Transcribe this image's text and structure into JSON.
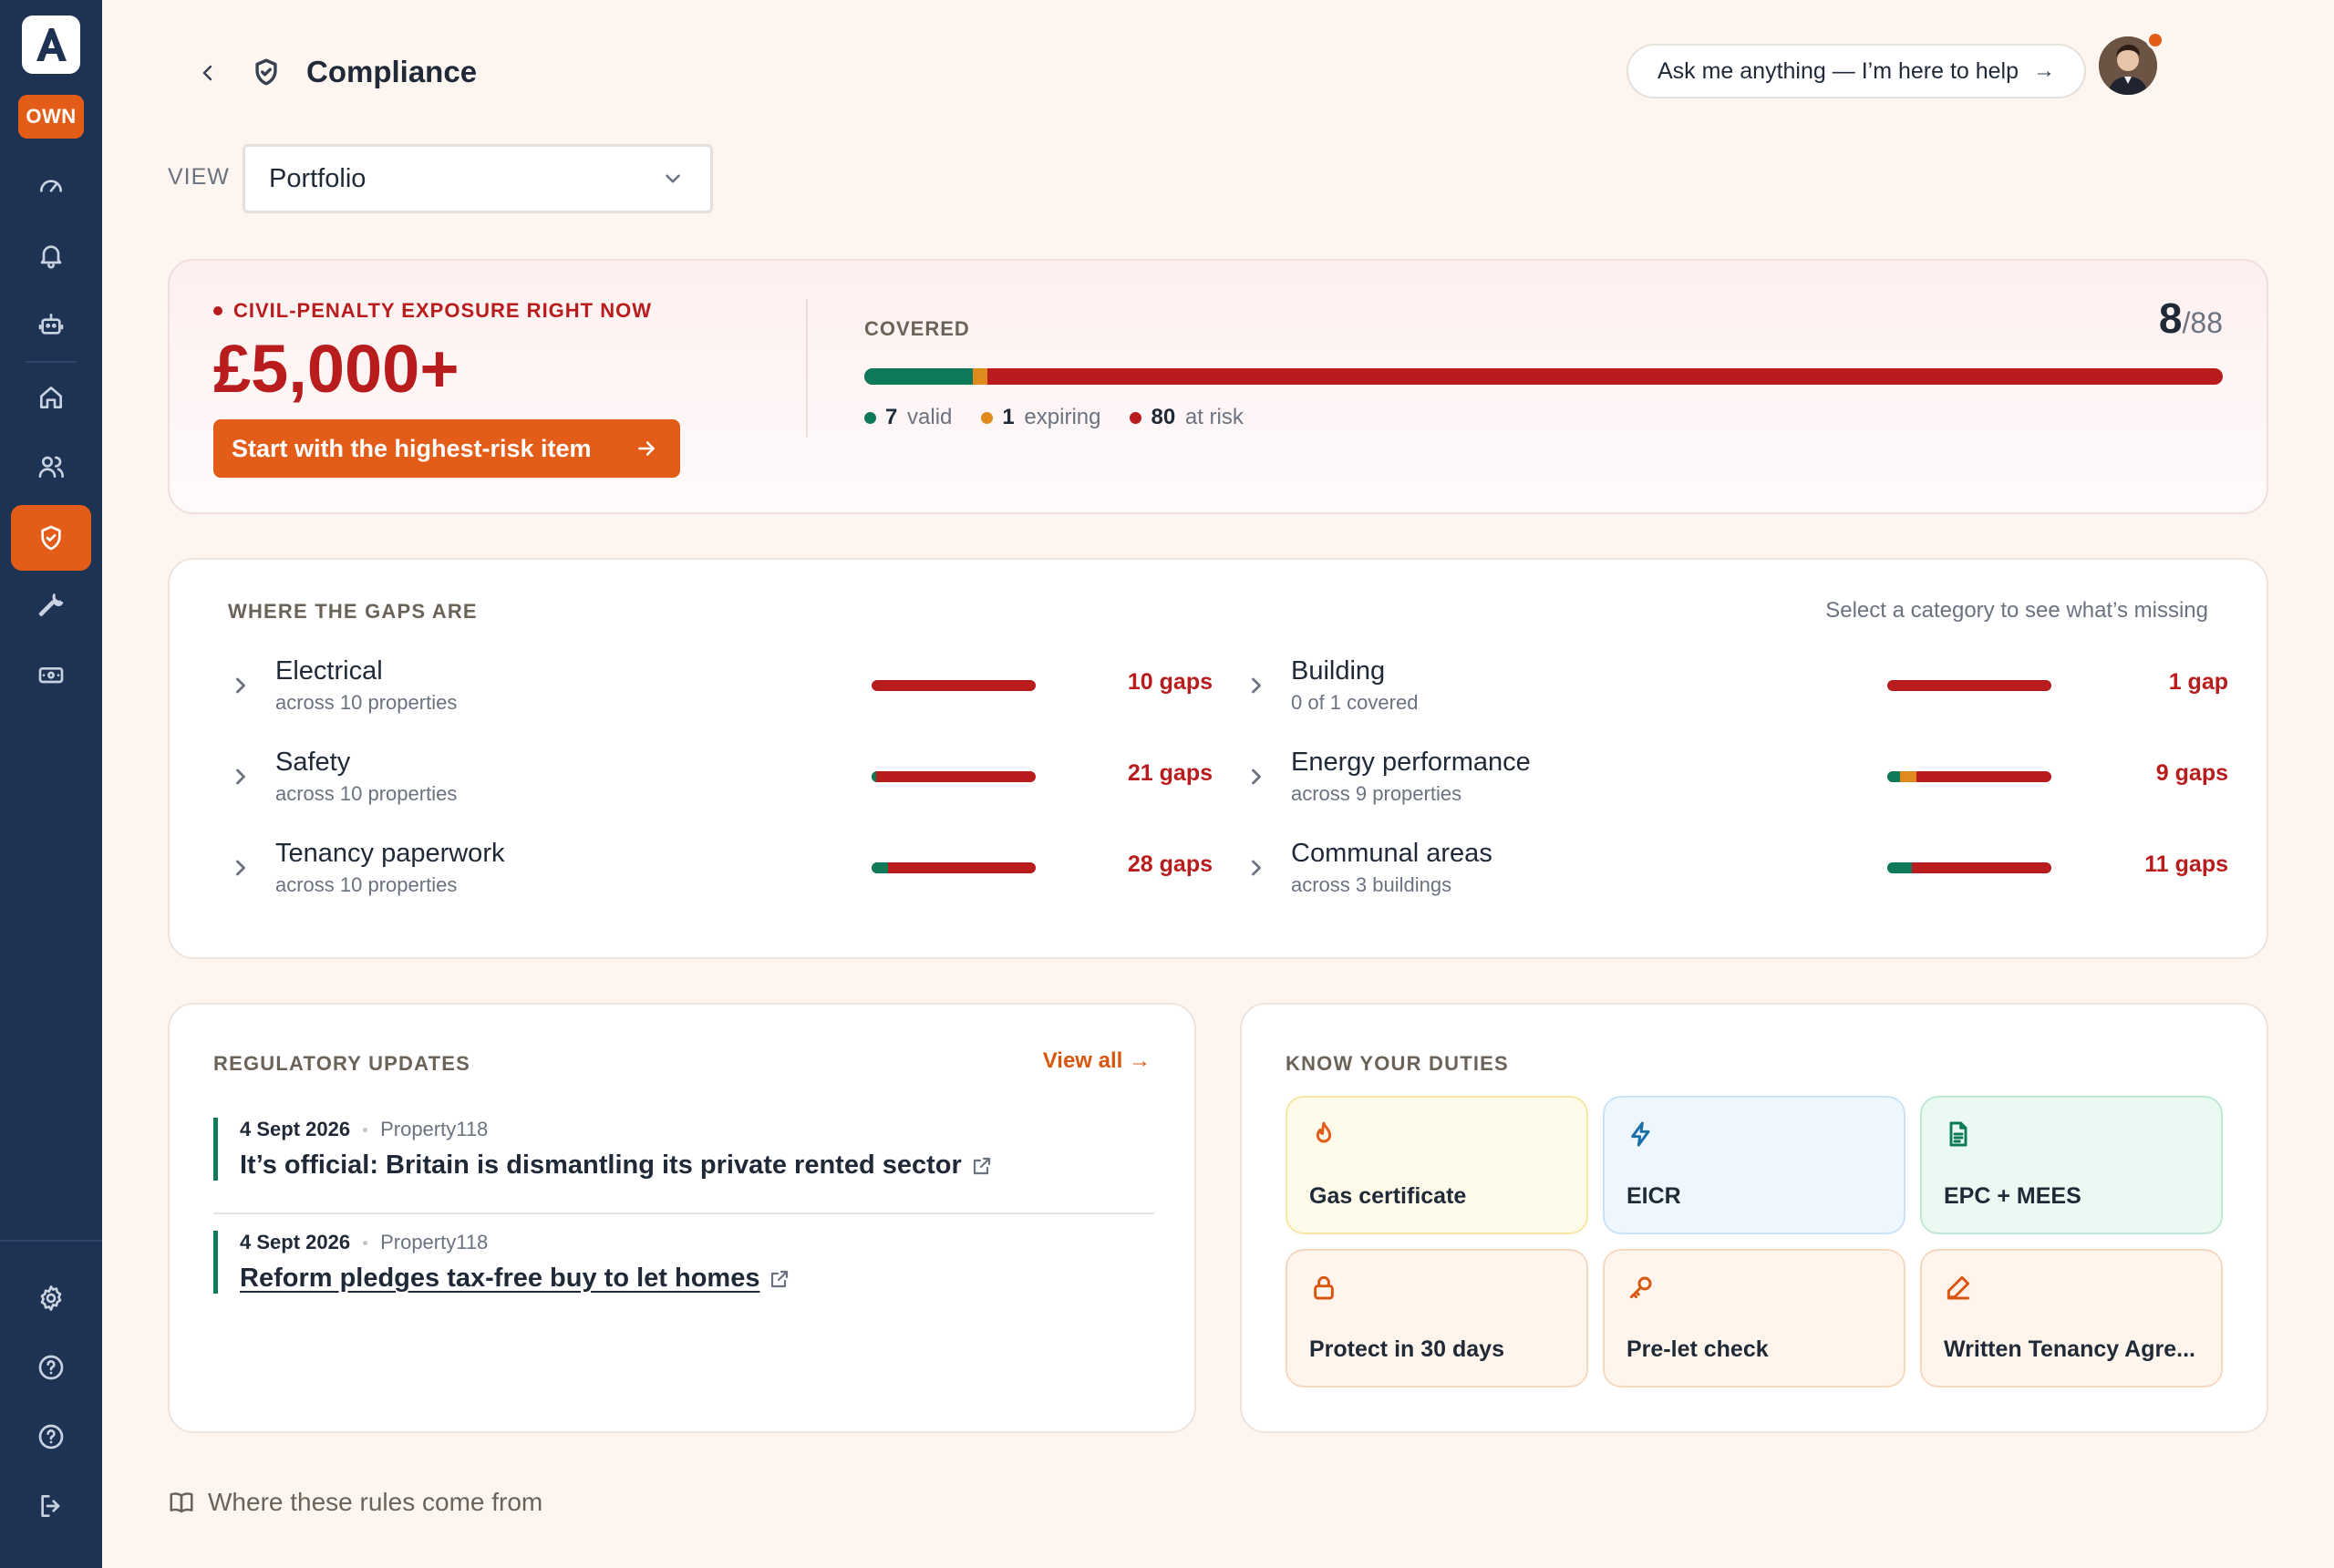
{
  "app": {
    "logo_letter": "A",
    "badge": "OWN"
  },
  "header": {
    "title": "Compliance",
    "ask_label": "Ask me anything — I’m here to help",
    "ask_arrow": "→"
  },
  "view": {
    "label": "VIEW",
    "selected": "Portfolio"
  },
  "hero": {
    "exposure_label": "CIVIL-PENALTY EXPOSURE RIGHT NOW",
    "exposure_amount": "£5,000+",
    "cta_label": "Start with the highest-risk item",
    "covered_label": "COVERED",
    "covered_value": "8",
    "covered_total": "/88",
    "valid_count": "7",
    "valid_label": "valid",
    "expiring_count": "1",
    "expiring_label": "expiring",
    "risk_count": "80",
    "risk_label": "at risk",
    "bar": {
      "valid": 7,
      "expiring": 1,
      "risk": 80,
      "total": 88
    }
  },
  "gaps": {
    "title": "WHERE THE GAPS ARE",
    "hint": "Select a category to see what’s missing",
    "items": [
      {
        "name": "Electrical",
        "sub": "across 10 properties",
        "count": "10 gaps",
        "valid": 0,
        "expiring": 0
      },
      {
        "name": "Building",
        "sub": "0 of 1 covered",
        "count": "1 gap",
        "valid": 0,
        "expiring": 0
      },
      {
        "name": "Safety",
        "sub": "across 10 properties",
        "count": "21 gaps",
        "valid": 0.03,
        "expiring": 0
      },
      {
        "name": "Energy performance",
        "sub": "across 9 properties",
        "count": "9 gaps",
        "valid": 0.08,
        "expiring": 0.1
      },
      {
        "name": "Tenancy paperwork",
        "sub": "across 10 properties",
        "count": "28 gaps",
        "valid": 0.1,
        "expiring": 0
      },
      {
        "name": "Communal areas",
        "sub": "across 3 buildings",
        "count": "11 gaps",
        "valid": 0.15,
        "expiring": 0
      }
    ]
  },
  "updates": {
    "title": "REGULATORY UPDATES",
    "view_all": "View all →",
    "items": [
      {
        "date": "4 Sept 2026",
        "source": "Property118",
        "headline": "It’s official: Britain is dismantling its private rented sector"
      },
      {
        "date": "4 Sept 2026",
        "source": "Property118",
        "headline": "Reform pledges tax-free buy to let homes"
      }
    ]
  },
  "duties": {
    "title": "KNOW YOUR DUTIES",
    "items": [
      {
        "label": "Gas certificate",
        "icon": "flame-icon"
      },
      {
        "label": "EICR",
        "icon": "lightning-icon"
      },
      {
        "label": "EPC + MEES",
        "icon": "document-icon"
      },
      {
        "label": "Protect in 30 days",
        "icon": "lock-icon"
      },
      {
        "label": "Pre-let check",
        "icon": "key-icon"
      },
      {
        "label": "Written Tenancy Agre...",
        "icon": "pen-icon"
      }
    ]
  },
  "footer": {
    "rules_link": "Where these rules come from"
  },
  "colors": {
    "accent": "#e35d18",
    "risk": "#b91c1c",
    "valid": "#0f7a5a",
    "expiring": "#e08a1e",
    "sidebar": "#1e3253"
  }
}
